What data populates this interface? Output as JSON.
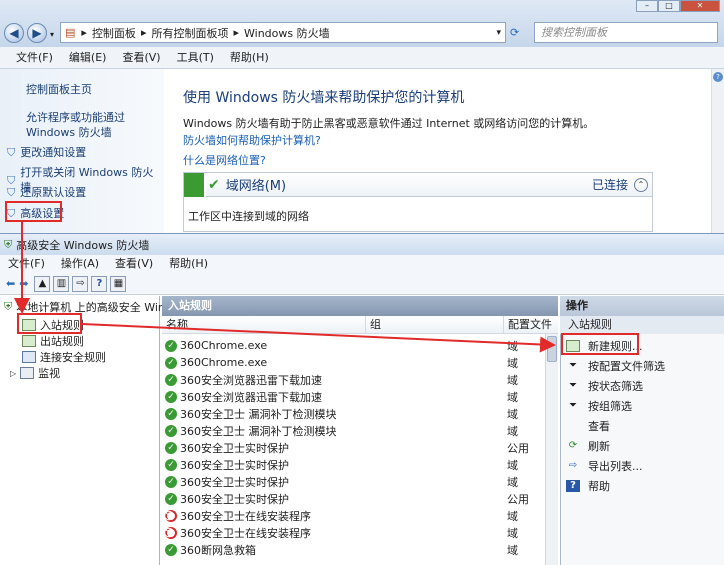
{
  "top": {
    "breadcrumb": [
      "控制面板",
      "所有控制面板项",
      "Windows 防火墙"
    ],
    "search_placeholder": "搜索控制面板",
    "menu": [
      "文件(F)",
      "编辑(E)",
      "查看(V)",
      "工具(T)",
      "帮助(H)"
    ]
  },
  "cp_side": {
    "home": "控制面板主页",
    "allow": "允许程序或功能通过 Windows 防火墙",
    "items": [
      "更改通知设置",
      "打开或关闭 Windows 防火墙",
      "还原默认设置",
      "高级设置"
    ]
  },
  "cp_main": {
    "title": "使用 Windows 防火墙来帮助保护您的计算机",
    "desc": "Windows 防火墙有助于防止黑客或恶意软件通过 Internet 或网络访问您的计算机。",
    "link1": "防火墙如何帮助保护计算机?",
    "link2": "什么是网络位置?",
    "net_title": "域网络(M)",
    "net_status": "已连接",
    "net_desc": "工作区中连接到域的网络"
  },
  "adv": {
    "title": "高级安全 Windows 防火墙",
    "menu": [
      "文件(F)",
      "操作(A)",
      "查看(V)",
      "帮助(H)"
    ],
    "tree": {
      "root": "本地计算机 上的高级安全 Wind",
      "items": [
        "入站规则",
        "出站规则",
        "连接安全规则",
        "监视"
      ]
    },
    "center_title": "入站规则",
    "col_name": "名称",
    "col_group": "组",
    "col_profile": "配置文件",
    "rows": [
      {
        "name": "360Chrome.exe",
        "group": "域",
        "status": "ok"
      },
      {
        "name": "360Chrome.exe",
        "group": "域",
        "status": "ok"
      },
      {
        "name": "360安全浏览器迅雷下载加速",
        "group": "域",
        "status": "ok"
      },
      {
        "name": "360安全浏览器迅雷下载加速",
        "group": "域",
        "status": "ok"
      },
      {
        "name": "360安全卫士 漏洞补丁检测模块",
        "group": "域",
        "status": "ok"
      },
      {
        "name": "360安全卫士 漏洞补丁检测模块",
        "group": "域",
        "status": "ok"
      },
      {
        "name": "360安全卫士实时保护",
        "group": "公用",
        "status": "ok"
      },
      {
        "name": "360安全卫士实时保护",
        "group": "域",
        "status": "ok"
      },
      {
        "name": "360安全卫士实时保护",
        "group": "域",
        "status": "ok"
      },
      {
        "name": "360安全卫士实时保护",
        "group": "公用",
        "status": "ok"
      },
      {
        "name": "360安全卫士在线安装程序",
        "group": "域",
        "status": "block"
      },
      {
        "name": "360安全卫士在线安装程序",
        "group": "域",
        "status": "block"
      },
      {
        "name": "360断网急救箱",
        "group": "域",
        "status": "ok"
      }
    ],
    "actions_title": "操作",
    "actions_sub": "入站规则",
    "actions": [
      "新建规则...",
      "按配置文件筛选",
      "按状态筛选",
      "按组筛选",
      "查看",
      "刷新",
      "导出列表...",
      "帮助"
    ]
  },
  "colors": {
    "highlight": "#e12a2a",
    "link": "#1b3f73",
    "title_blue": "#1a3e7a"
  }
}
